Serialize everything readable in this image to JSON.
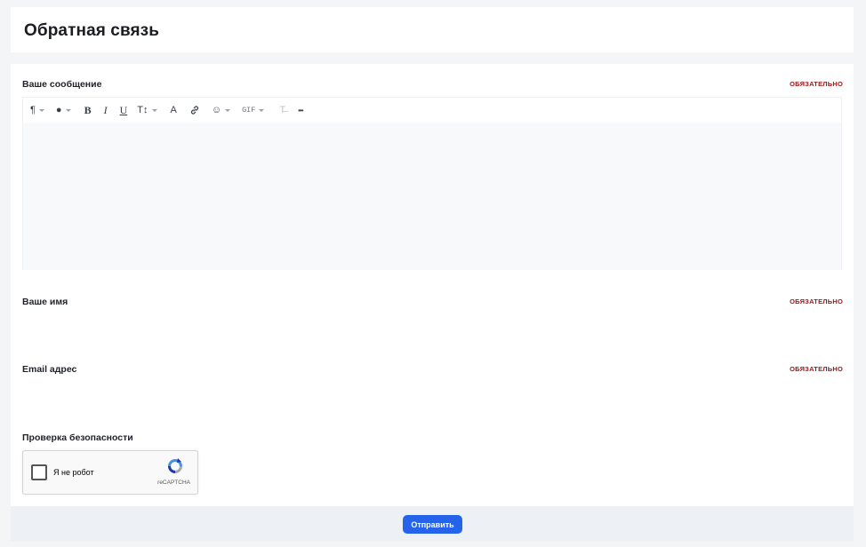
{
  "header": {
    "title": "Обратная связь"
  },
  "form": {
    "message": {
      "label": "Ваше сообщение",
      "required": "ОБЯЗАТЕЛЬНО",
      "value": "",
      "toolbar": {
        "paragraph": "¶",
        "color": "●",
        "bold": "B",
        "italic": "I",
        "underline": "U",
        "font_size": "T↕",
        "format_painter": "A",
        "link": "🔗",
        "emoji": "☺",
        "gif": "GIF",
        "clear_format": "T̶",
        "more": "•••"
      }
    },
    "name": {
      "label": "Ваше имя",
      "required": "ОБЯЗАТЕЛЬНО",
      "value": ""
    },
    "email": {
      "label": "Email адрес",
      "required": "ОБЯЗАТЕЛЬНО",
      "value": ""
    },
    "security": {
      "label": "Проверка безопасности",
      "captcha_label": "Я не робот",
      "captcha_brand": "reCAPTCHA"
    }
  },
  "footer": {
    "submit_label": "Отправить"
  },
  "colors": {
    "accent": "#2563eb",
    "required": "#a11a1a"
  }
}
